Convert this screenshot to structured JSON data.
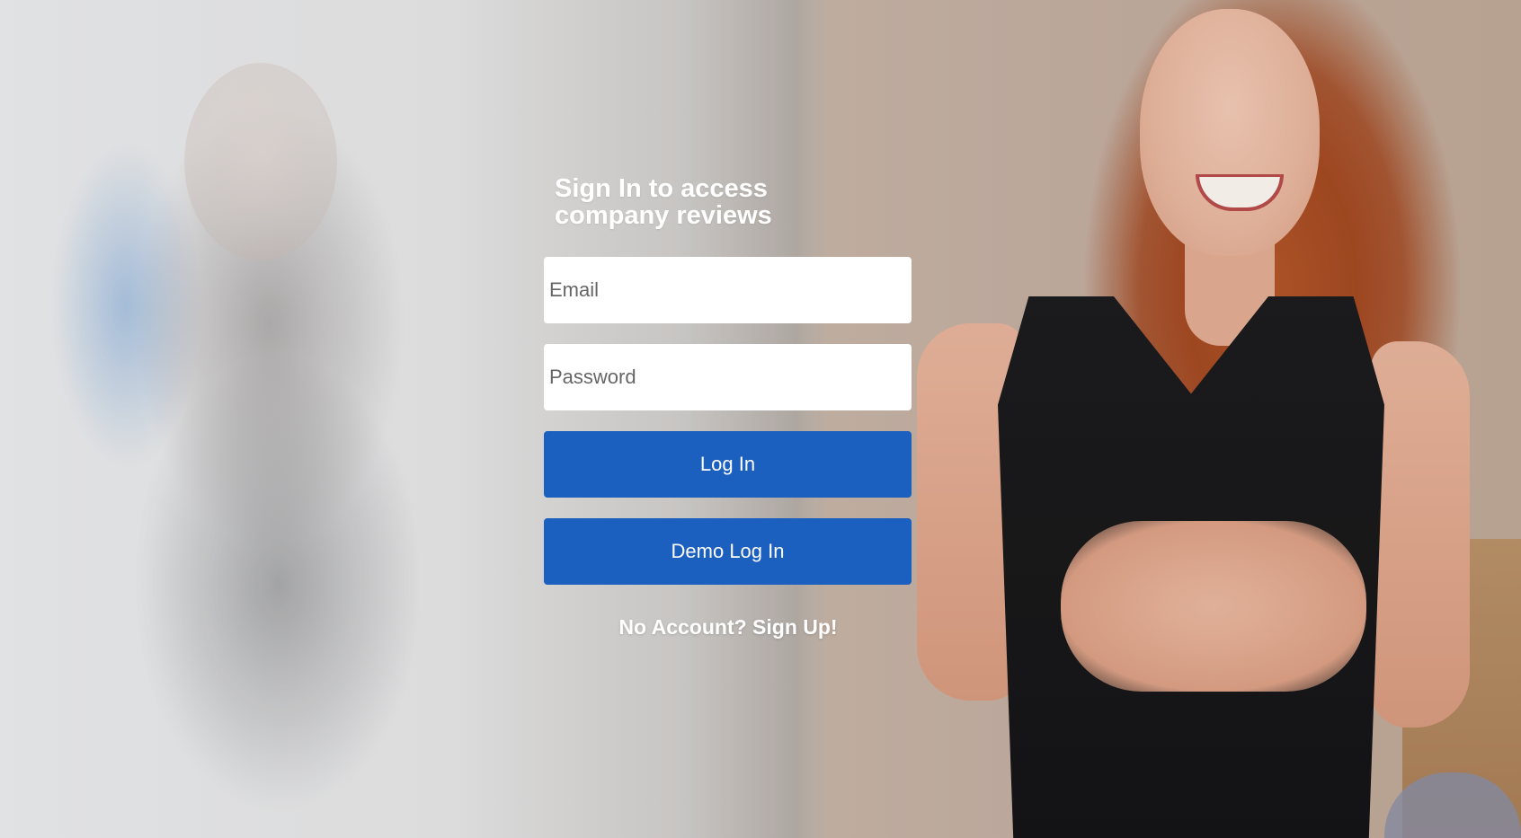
{
  "login": {
    "title": "Sign In to access company reviews",
    "email_placeholder": "Email",
    "password_placeholder": "Password",
    "login_button": "Log In",
    "demo_button": "Demo Log In",
    "signup_link": "No Account? Sign Up!"
  },
  "theme": {
    "button_color": "#1b5fbf",
    "title_color": "#ffffff"
  },
  "background": {
    "image_semantic": "background-photo-smiling-woman"
  }
}
